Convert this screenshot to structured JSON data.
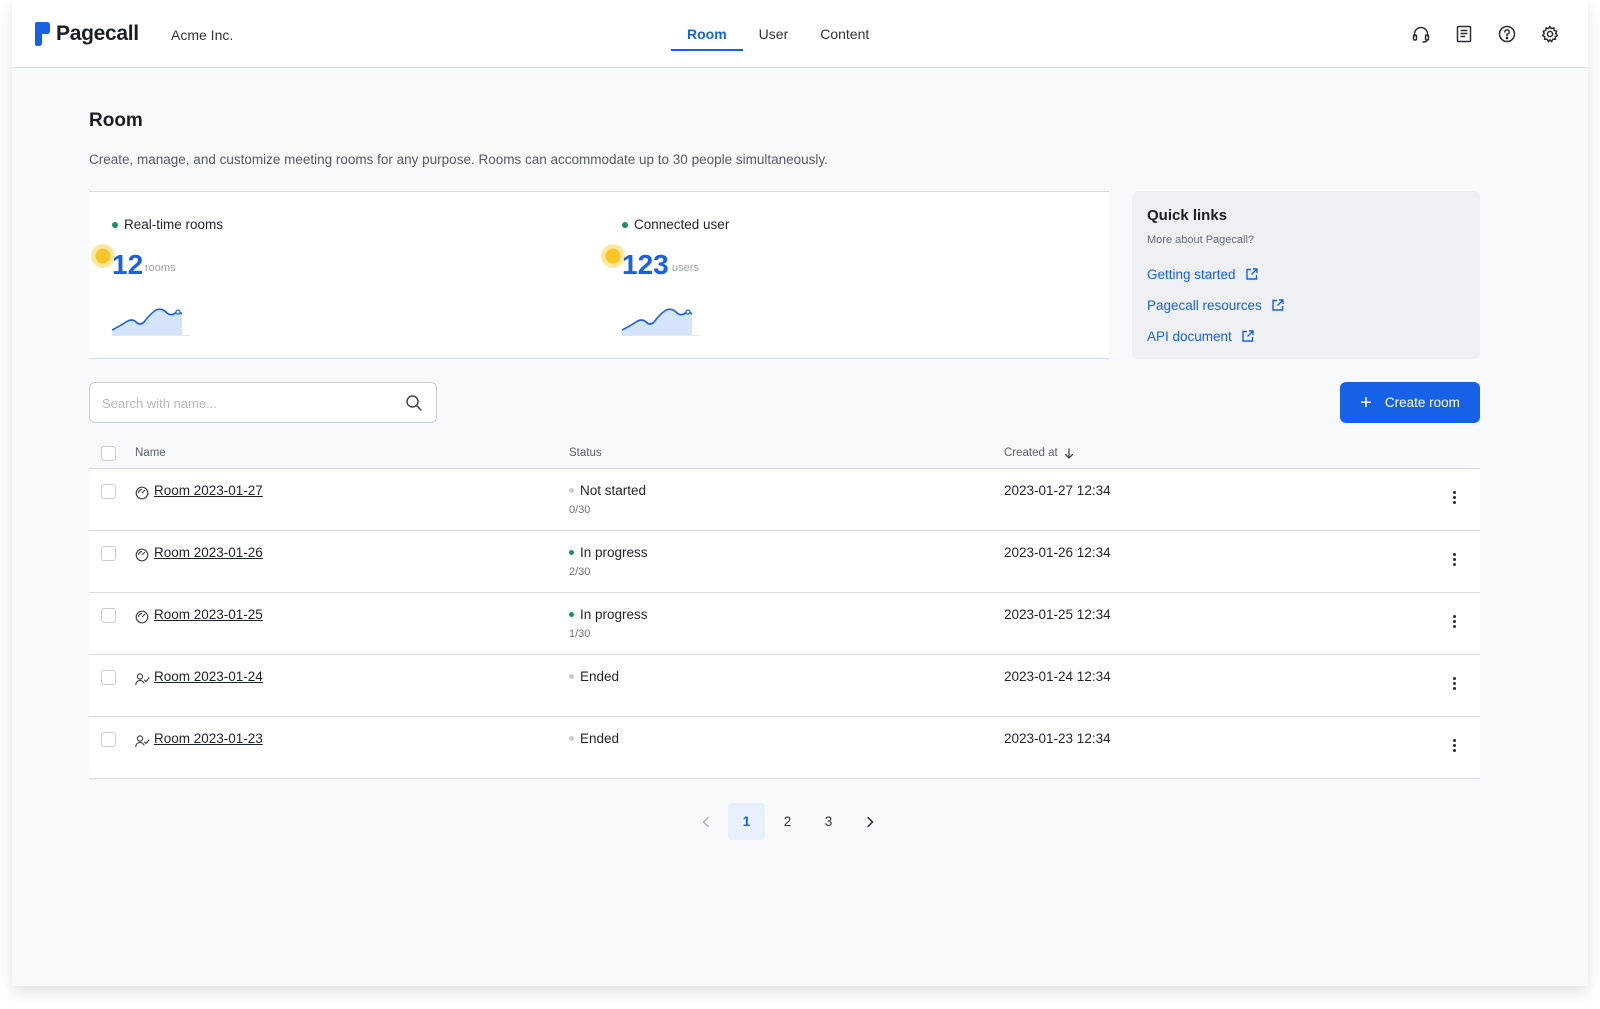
{
  "header": {
    "brand": "Pagecall",
    "org": "Acme Inc.",
    "tabs": [
      {
        "label": "Room",
        "active": true
      },
      {
        "label": "User",
        "active": false
      },
      {
        "label": "Content",
        "active": false
      }
    ],
    "icons": [
      "headset-icon",
      "document-icon",
      "help-icon",
      "settings-icon"
    ]
  },
  "page": {
    "title": "Room",
    "description": "Create, manage, and customize meeting rooms for any purpose. Rooms can accommodate up to 30 people simultaneously."
  },
  "stats": [
    {
      "label": "Real-time rooms",
      "value": "12",
      "unit": "rooms"
    },
    {
      "label": "Connected user",
      "value": "123",
      "unit": "users"
    }
  ],
  "quick_links": {
    "title": "Quick links",
    "subtitle": "More about Pagecall?",
    "links": [
      "Getting started",
      "Pagecall resources",
      "API document"
    ]
  },
  "search": {
    "placeholder": "Search with name..."
  },
  "create_button": "Create room",
  "table": {
    "columns": {
      "name": "Name",
      "status": "Status",
      "created": "Created at"
    },
    "rows": [
      {
        "name": "Room 2023-01-27",
        "status": "Not started",
        "capacity": "0/30",
        "created": "2023-01-27 12:34",
        "icon": "timer-icon",
        "status_color": "#c9ccd1"
      },
      {
        "name": "Room 2023-01-26",
        "status": "In progress",
        "capacity": "2/30",
        "created": "2023-01-26 12:34",
        "icon": "timer-icon",
        "status_color": "#16925c"
      },
      {
        "name": "Room 2023-01-25",
        "status": "In progress",
        "capacity": "1/30",
        "created": "2023-01-25 12:34",
        "icon": "timer-icon",
        "status_color": "#16925c"
      },
      {
        "name": "Room 2023-01-24",
        "status": "Ended",
        "capacity": "",
        "created": "2023-01-24 12:34",
        "icon": "user-check-icon",
        "status_color": "#c9ccd1"
      },
      {
        "name": "Room 2023-01-23",
        "status": "Ended",
        "capacity": "",
        "created": "2023-01-23 12:34",
        "icon": "user-check-icon",
        "status_color": "#c9ccd1"
      }
    ]
  },
  "pagination": {
    "pages": [
      "1",
      "2",
      "3"
    ],
    "current": "1"
  },
  "colors": {
    "accent": "#1761e6",
    "status_active": "#16925c",
    "status_idle": "#c9ccd1"
  }
}
